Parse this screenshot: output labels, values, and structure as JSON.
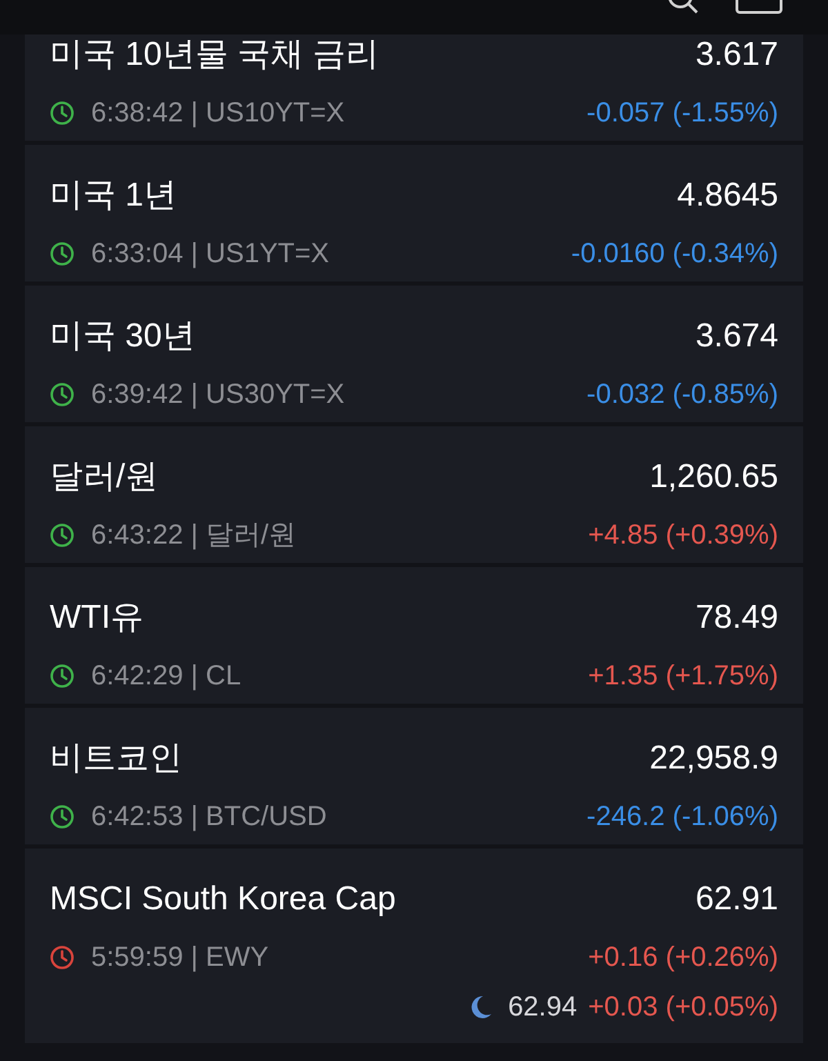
{
  "quotes": [
    {
      "name": "미국 10년물 국채 금리",
      "price": "3.617",
      "time_symbol": "6:38:42 | US10YT=X",
      "change": "-0.057 (-1.55%)",
      "rising": false,
      "market_open": true
    },
    {
      "name": "미국 1년",
      "price": "4.8645",
      "time_symbol": "6:33:04 | US1YT=X",
      "change": "-0.0160 (-0.34%)",
      "rising": false,
      "market_open": true
    },
    {
      "name": "미국 30년",
      "price": "3.674",
      "time_symbol": "6:39:42 | US30YT=X",
      "change": "-0.032 (-0.85%)",
      "rising": false,
      "market_open": true
    },
    {
      "name": "달러/원",
      "price": "1,260.65",
      "time_symbol": "6:43:22 | 달러/원",
      "change": "+4.85 (+0.39%)",
      "rising": true,
      "market_open": true
    },
    {
      "name": "WTI유",
      "price": "78.49",
      "time_symbol": "6:42:29 | CL",
      "change": "+1.35 (+1.75%)",
      "rising": true,
      "market_open": true
    },
    {
      "name": "비트코인",
      "price": "22,958.9",
      "time_symbol": "6:42:53 | BTC/USD",
      "change": "-246.2 (-1.06%)",
      "rising": false,
      "market_open": true
    },
    {
      "name": "MSCI South Korea Cap",
      "price": "62.91",
      "time_symbol": "5:59:59 | EWY",
      "change": "+0.16 (+0.26%)",
      "rising": true,
      "market_open": false,
      "after_hours": {
        "price": "62.94",
        "change": "+0.03 (+0.05%)",
        "rising": true
      }
    }
  ]
}
